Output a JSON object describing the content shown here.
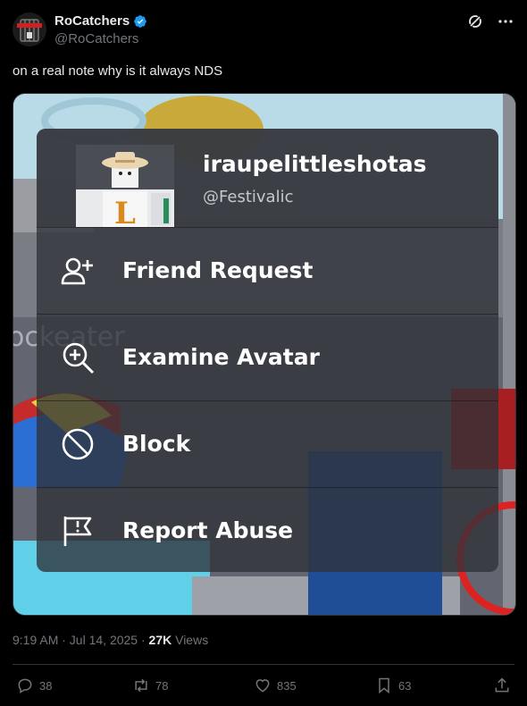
{
  "tweet": {
    "author": {
      "display_name": "RoCatchers",
      "handle": "@RoCatchers",
      "verified": true
    },
    "text": "on a real note why is it always NDS",
    "timestamp": "9:19 AM · Jul 14, 2025 · ",
    "views_count": "27K",
    "views_label": " Views"
  },
  "media": {
    "bg_text": "ockeater",
    "menu": {
      "username": "iraupelittleshotas",
      "handle": "@Festivalic",
      "items": [
        {
          "label": "Friend Request",
          "icon": "add-friend-icon"
        },
        {
          "label": "Examine Avatar",
          "icon": "zoom-in-icon"
        },
        {
          "label": "Block",
          "icon": "block-icon"
        },
        {
          "label": "Report Abuse",
          "icon": "report-flag-icon"
        }
      ]
    }
  },
  "actions": {
    "replies": "38",
    "reposts": "78",
    "likes": "835",
    "bookmarks": "63"
  },
  "colors": {
    "background": "#000000",
    "text": "#e7e9ea",
    "muted": "#71767b",
    "verified": "#1d9bf0"
  }
}
